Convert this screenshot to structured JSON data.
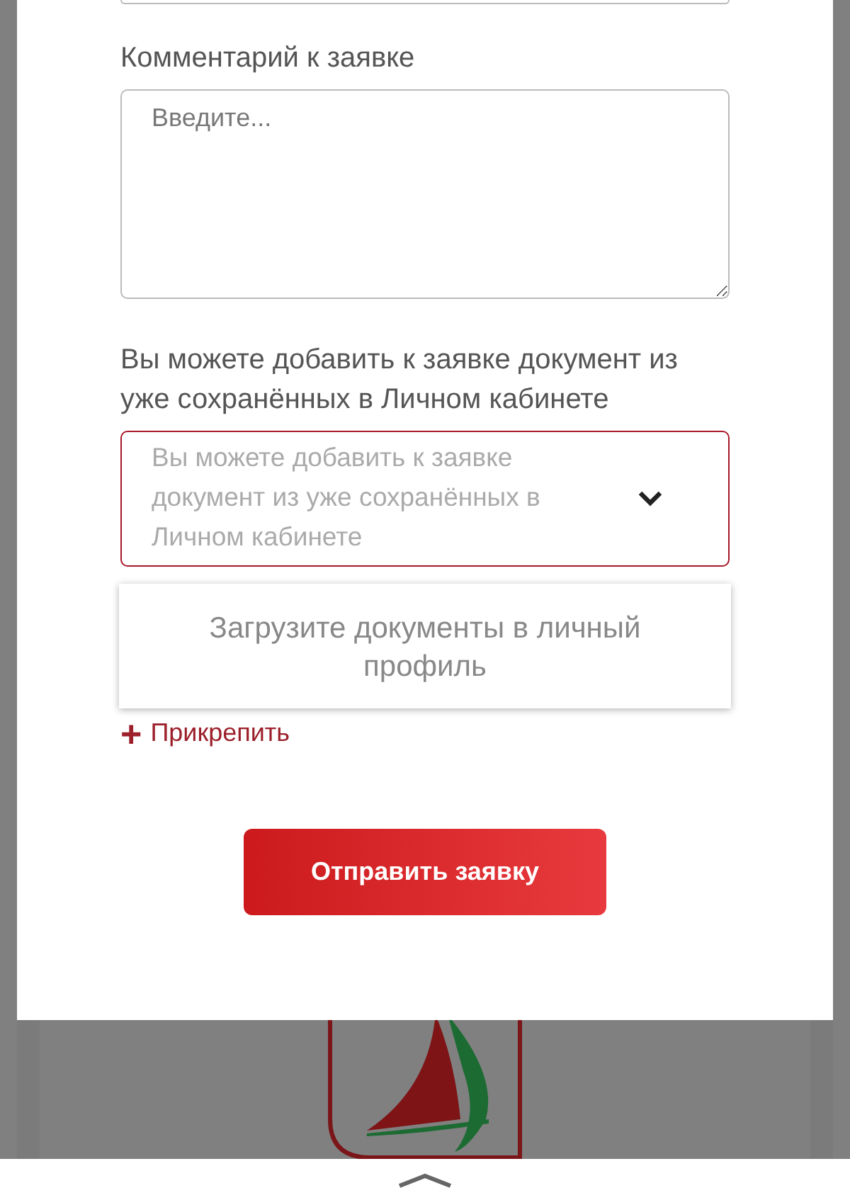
{
  "comment_field": {
    "label": "Комментарий к заявке",
    "placeholder": "Введите..."
  },
  "document_select": {
    "label": "Вы можете добавить к заявке документ из уже сохранённых в Личном кабинете",
    "placeholder": "Вы можете добавить к заявке документ из уже сохранённых в Личном кабинете",
    "invalid": true,
    "expanded": true,
    "menu_message": "Загрузите документы в личный профиль"
  },
  "attach_link": {
    "icon": "+",
    "label": "Прикрепить"
  },
  "submit_button": {
    "label": "Отправить заявку"
  }
}
